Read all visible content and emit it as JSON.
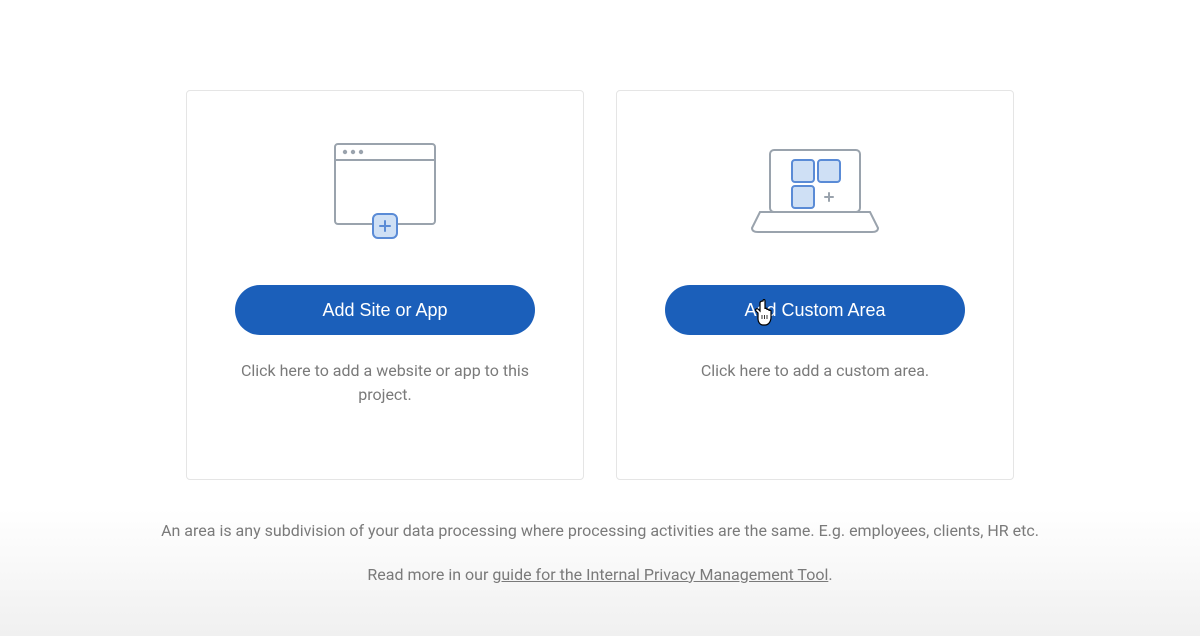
{
  "cards": {
    "siteOrApp": {
      "button_label": "Add Site or App",
      "description": "Click here to add a website or app to this project."
    },
    "customArea": {
      "button_label": "Add Custom Area",
      "description": "Click here to add a custom area."
    }
  },
  "footer": {
    "info_text": "An area is any subdivision of your data processing where processing activities are the same. E.g. employees, clients, HR etc.",
    "read_more_prefix": "Read more in our ",
    "read_more_link": "guide for the Internal Privacy Management Tool",
    "read_more_suffix": "."
  }
}
